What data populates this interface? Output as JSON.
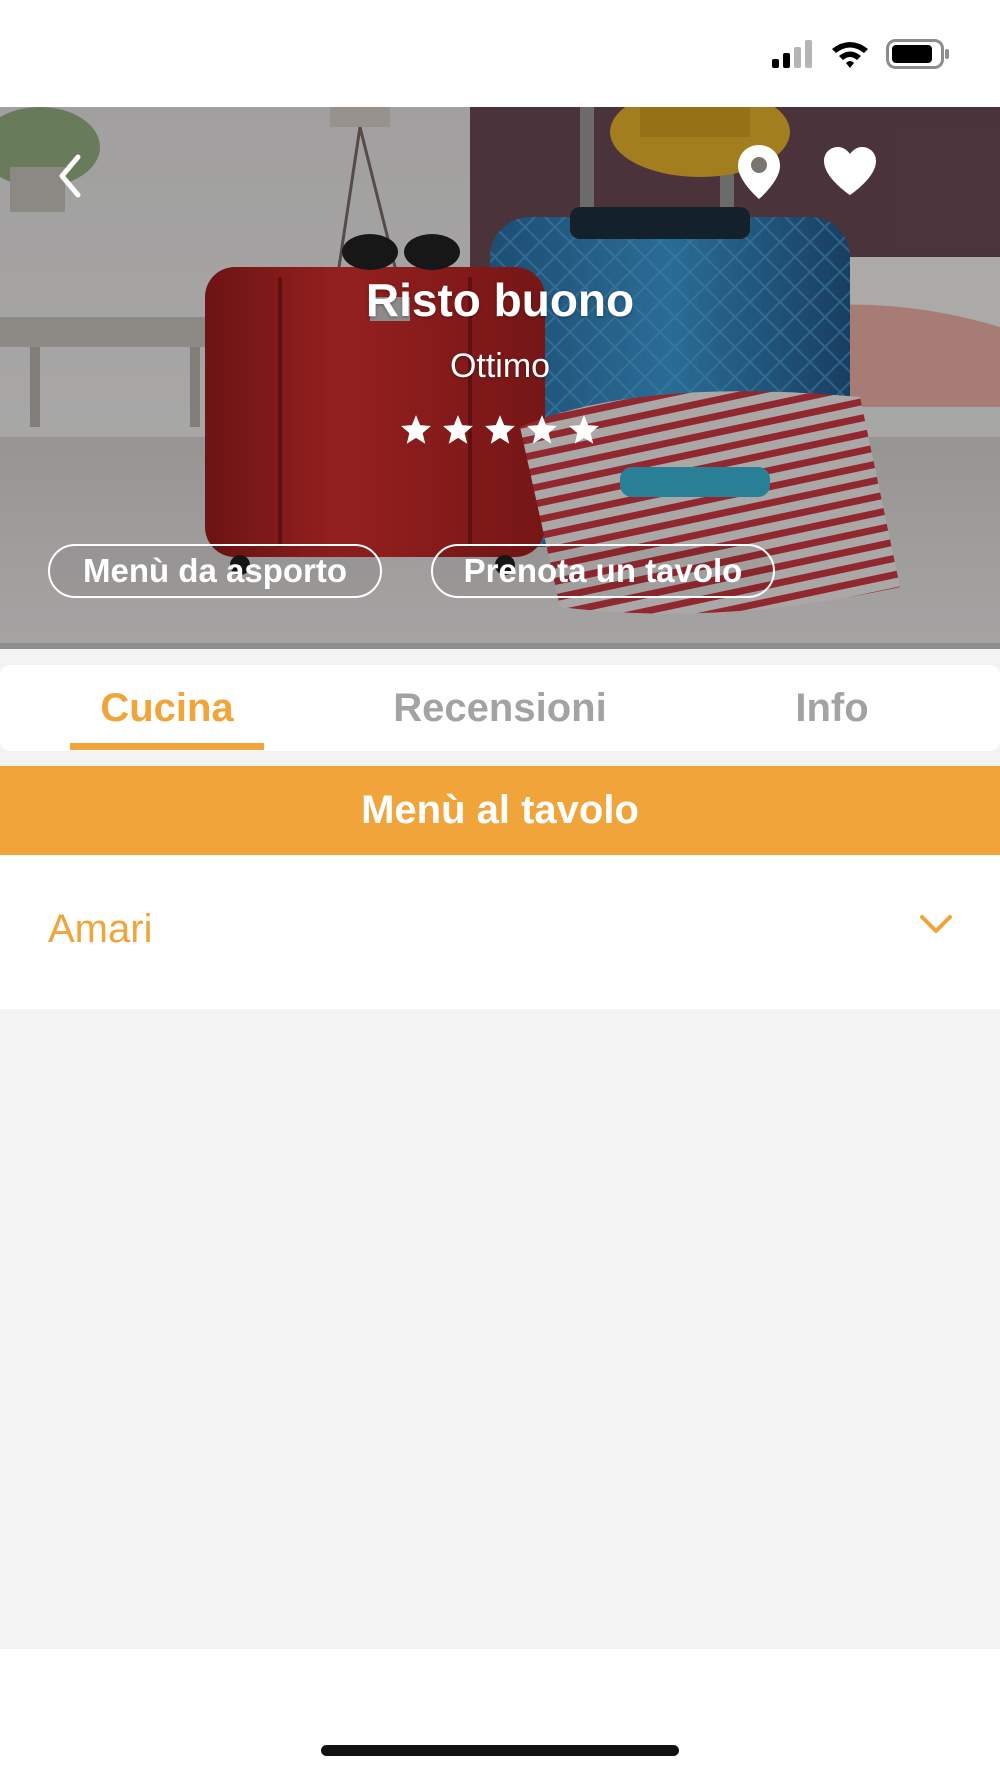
{
  "restaurant": {
    "name": "Risto buono",
    "rating_label": "Ottimo",
    "stars": 5
  },
  "hero_actions": {
    "takeaway_label": "Menù da asporto",
    "book_label": "Prenota un tavolo"
  },
  "tabs": [
    {
      "label": "Cucina",
      "active": true
    },
    {
      "label": "Recensioni",
      "active": false
    },
    {
      "label": "Info",
      "active": false
    }
  ],
  "menu_section": {
    "title": "Menù al tavolo"
  },
  "categories": [
    {
      "label": "Amari",
      "expanded": false
    }
  ],
  "icons": {
    "back": "chevron-left-icon",
    "location": "map-pin-icon",
    "favorite": "heart-icon",
    "expand": "chevron-down-icon"
  },
  "colors": {
    "accent": "#f0a43a",
    "tab_inactive": "#a3a3a3",
    "content_background": "#f3f3f3"
  }
}
